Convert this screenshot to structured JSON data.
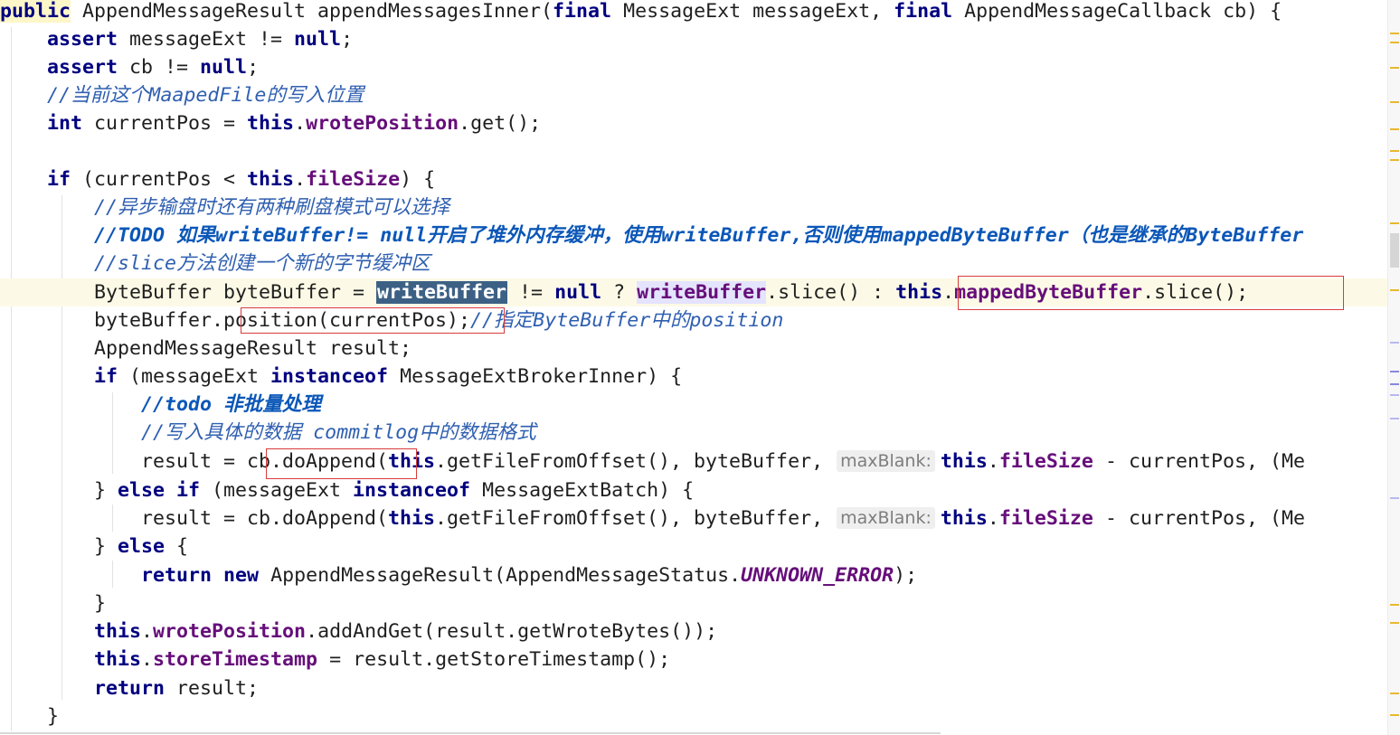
{
  "editor": {
    "language": "java",
    "lines": [
      {
        "segments": [
          {
            "t": "public",
            "c": "kw hl-pub"
          },
          {
            "t": " AppendMessageResult appendMessagesInner("
          },
          {
            "t": "final",
            "c": "kw"
          },
          {
            "t": " MessageExt messageExt, "
          },
          {
            "t": "final",
            "c": "kw"
          },
          {
            "t": " AppendMessageCallback cb) {"
          }
        ]
      },
      {
        "segments": [
          {
            "t": "    "
          },
          {
            "t": "assert",
            "c": "kw"
          },
          {
            "t": " messageExt != "
          },
          {
            "t": "null",
            "c": "kw"
          },
          {
            "t": ";"
          }
        ]
      },
      {
        "segments": [
          {
            "t": "    "
          },
          {
            "t": "assert",
            "c": "kw"
          },
          {
            "t": " cb != "
          },
          {
            "t": "null",
            "c": "kw"
          },
          {
            "t": ";"
          }
        ]
      },
      {
        "segments": [
          {
            "t": "    "
          },
          {
            "t": "//当前这个MaapedFile的写入位置",
            "c": "cm"
          }
        ]
      },
      {
        "segments": [
          {
            "t": "    "
          },
          {
            "t": "int",
            "c": "kw"
          },
          {
            "t": " currentPos = "
          },
          {
            "t": "this",
            "c": "kw"
          },
          {
            "t": "."
          },
          {
            "t": "wrotePosition",
            "c": "fld"
          },
          {
            "t": ".get();"
          }
        ]
      },
      {
        "segments": [
          {
            "t": ""
          }
        ]
      },
      {
        "segments": [
          {
            "t": "    "
          },
          {
            "t": "if",
            "c": "kw"
          },
          {
            "t": " (currentPos < "
          },
          {
            "t": "this",
            "c": "kw"
          },
          {
            "t": "."
          },
          {
            "t": "fileSize",
            "c": "fld"
          },
          {
            "t": ") {"
          }
        ]
      },
      {
        "segments": [
          {
            "t": "        "
          },
          {
            "t": "//异步输盘时还有两种刷盘模式可以选择",
            "c": "cm"
          }
        ]
      },
      {
        "segments": [
          {
            "t": "        "
          },
          {
            "t": "//TODO 如果writeBuffer!= null开启了堆外内存缓冲，使用writeBuffer,否则使用mappedByteBuffer（也是继承的ByteBuffer",
            "c": "cmb"
          }
        ]
      },
      {
        "segments": [
          {
            "t": "        "
          },
          {
            "t": "//slice方法创建一个新的字节缓冲区",
            "c": "cm"
          }
        ]
      },
      {
        "caret": true,
        "segments": [
          {
            "t": "        ByteBuffer byteBuffer = "
          },
          {
            "t": "writeBuffer",
            "c": "sel"
          },
          {
            "t": " != "
          },
          {
            "t": "null",
            "c": "kw"
          },
          {
            "t": " ? "
          },
          {
            "t": "writeBuffer",
            "c": "fld hl"
          },
          {
            "t": ".slice() : "
          },
          {
            "t": "this",
            "c": "kw"
          },
          {
            "t": "."
          },
          {
            "t": "mappedByteBuffer",
            "c": "fld"
          },
          {
            "t": ".slice();"
          }
        ]
      },
      {
        "segments": [
          {
            "t": "        byteBuffer.position(currentPos);"
          },
          {
            "t": "//指定ByteBuffer中的position",
            "c": "cm"
          }
        ]
      },
      {
        "segments": [
          {
            "t": "        AppendMessageResult result;"
          }
        ]
      },
      {
        "segments": [
          {
            "t": "        "
          },
          {
            "t": "if",
            "c": "kw"
          },
          {
            "t": " (messageExt "
          },
          {
            "t": "instanceof",
            "c": "kw"
          },
          {
            "t": " MessageExtBrokerInner) {"
          }
        ]
      },
      {
        "segments": [
          {
            "t": "            "
          },
          {
            "t": "//todo 非批量处理",
            "c": "cmb"
          }
        ]
      },
      {
        "segments": [
          {
            "t": "            "
          },
          {
            "t": "//写入具体的数据 commitlog中的数据格式",
            "c": "cm"
          }
        ]
      },
      {
        "segments": [
          {
            "t": "            result = cb.doAppend("
          },
          {
            "t": "this",
            "c": "kw"
          },
          {
            "t": ".getFileFromOffset(), byteBuffer, "
          },
          {
            "t": "maxBlank:",
            "c": "hint"
          },
          {
            "t": "this",
            "c": "kw"
          },
          {
            "t": "."
          },
          {
            "t": "fileSize",
            "c": "fld"
          },
          {
            "t": " - currentPos, (Me"
          }
        ]
      },
      {
        "segments": [
          {
            "t": "        } "
          },
          {
            "t": "else if",
            "c": "kw"
          },
          {
            "t": " (messageExt "
          },
          {
            "t": "instanceof",
            "c": "kw"
          },
          {
            "t": " MessageExtBatch) {"
          }
        ]
      },
      {
        "segments": [
          {
            "t": "            result = cb.doAppend("
          },
          {
            "t": "this",
            "c": "kw"
          },
          {
            "t": ".getFileFromOffset(), byteBuffer, "
          },
          {
            "t": "maxBlank:",
            "c": "hint"
          },
          {
            "t": "this",
            "c": "kw"
          },
          {
            "t": "."
          },
          {
            "t": "fileSize",
            "c": "fld"
          },
          {
            "t": " - currentPos, (Me"
          }
        ]
      },
      {
        "segments": [
          {
            "t": "        } "
          },
          {
            "t": "else",
            "c": "kw"
          },
          {
            "t": " {"
          }
        ]
      },
      {
        "segments": [
          {
            "t": "            "
          },
          {
            "t": "return",
            "c": "kw"
          },
          {
            "t": " "
          },
          {
            "t": "new",
            "c": "kw"
          },
          {
            "t": " AppendMessageResult(AppendMessageStatus."
          },
          {
            "t": "UNKNOWN_ERROR",
            "c": "cst"
          },
          {
            "t": ");"
          }
        ]
      },
      {
        "segments": [
          {
            "t": "        }"
          }
        ]
      },
      {
        "segments": [
          {
            "t": "        "
          },
          {
            "t": "this",
            "c": "kw"
          },
          {
            "t": "."
          },
          {
            "t": "wrotePosition",
            "c": "fld"
          },
          {
            "t": ".addAndGet(result.getWroteBytes());"
          }
        ]
      },
      {
        "segments": [
          {
            "t": "        "
          },
          {
            "t": "this",
            "c": "kw"
          },
          {
            "t": "."
          },
          {
            "t": "storeTimestamp",
            "c": "fld"
          },
          {
            "t": " = result.getStoreTimestamp();"
          }
        ]
      },
      {
        "segments": [
          {
            "t": "        "
          },
          {
            "t": "return",
            "c": "kw"
          },
          {
            "t": " result;"
          }
        ]
      },
      {
        "segments": [
          {
            "t": "    }"
          }
        ]
      }
    ]
  },
  "colors": {
    "keyword": "#000080",
    "field": "#660e7a",
    "comment": "#2f5fb0",
    "selection": "#3d6185",
    "caret_line": "#fcfae6",
    "annotation_box": "#d83b3b"
  }
}
